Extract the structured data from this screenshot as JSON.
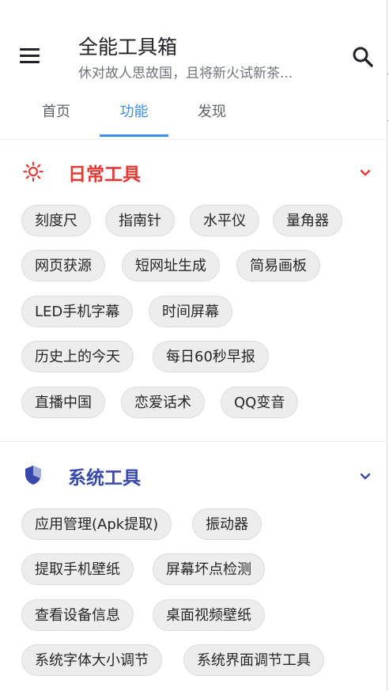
{
  "header": {
    "title": "全能工具箱",
    "subtitle": "休对故人思故国，且将新火试新茶...",
    "menu_icon": "hamburger-menu-icon",
    "search_icon": "search-icon"
  },
  "tabs": [
    {
      "label": "首页",
      "active": false
    },
    {
      "label": "功能",
      "active": true
    },
    {
      "label": "发现",
      "active": false
    }
  ],
  "colors": {
    "accent_blue": "#3c8dee",
    "daily_red": "#e53935",
    "system_indigo": "#3949ab",
    "chip_bg": "#ededed"
  },
  "sections": [
    {
      "title": "日常工具",
      "icon": "sun-icon",
      "expanded": true,
      "items": [
        "刻度尺",
        "指南针",
        "水平仪",
        "量角器",
        "网页获源",
        "短网址生成",
        "简易画板",
        "LED手机字幕",
        "时间屏幕",
        "历史上的今天",
        "每日60秒早报",
        "直播中国",
        "恋爱话术",
        "QQ变音"
      ]
    },
    {
      "title": "系统工具",
      "icon": "shield-icon",
      "expanded": true,
      "items": [
        "应用管理(Apk提取)",
        "振动器",
        "提取手机壁纸",
        "屏幕坏点检测",
        "查看设备信息",
        "桌面视频壁纸",
        "系统字体大小调节",
        "系统界面调节工具"
      ]
    }
  ]
}
